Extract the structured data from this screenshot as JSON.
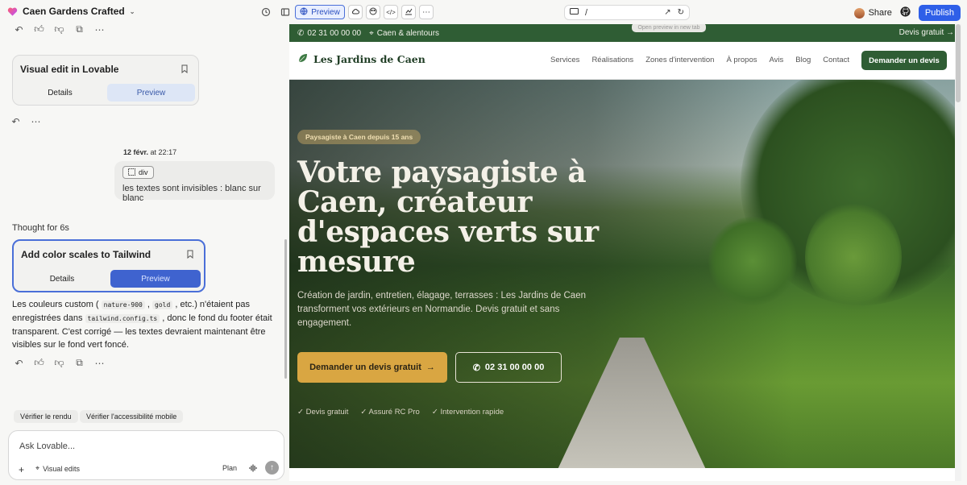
{
  "topbar": {
    "project_name": "Caen Gardens Crafted",
    "preview_label": "Preview",
    "address_path": "/",
    "share_label": "Share",
    "publish_label": "Publish"
  },
  "chat": {
    "card1": {
      "title": "Visual edit in Lovable",
      "details": "Details",
      "preview": "Preview"
    },
    "timestamp_date": "12 févr.",
    "timestamp_time": "at 22:17",
    "user_chip": "div",
    "user_message": "les textes sont invisibles : blanc sur blanc",
    "thought": "Thought for 6s",
    "card2": {
      "title": "Add color scales to Tailwind",
      "details": "Details",
      "preview": "Preview"
    },
    "reply": {
      "p1": "Les couleurs custom (",
      "code1": "nature-900",
      "p2": ",",
      "code2": "gold",
      "p3": ", etc.) n'étaient pas enregistrées dans",
      "code3": "tailwind.config.ts",
      "p4": ", donc le fond du footer était transparent. C'est corrigé — les textes devraient maintenant être visibles sur le fond vert foncé."
    },
    "suggestions": [
      "Vérifier le rendu",
      "Vérifier l'accessibilité mobile"
    ],
    "input_placeholder": "Ask Lovable...",
    "visual_edits": "Visual edits",
    "plan": "Plan"
  },
  "site": {
    "phone": "02 31 00 00 00",
    "area": "Caen & alentours",
    "devis_top": "Devis gratuit →",
    "tooltip": "Open preview in new tab",
    "brand": "Les Jardins de Caen",
    "menu": [
      "Services",
      "Réalisations",
      "Zones d'intervention",
      "À propos",
      "Avis",
      "Blog",
      "Contact"
    ],
    "cta_nav": "Demander un devis",
    "badge": "Paysagiste à Caen depuis 15 ans",
    "headline": "Votre paysagiste à Caen, créateur d'espaces verts sur mesure",
    "lead": "Création de jardin, entretien, élagage, terrasses : Les Jardins de Caen transforment vos extérieurs en Normandie. Devis gratuit et sans engagement.",
    "cta_primary": "Demander un devis gratuit",
    "cta_phone": "02 31 00 00 00",
    "checks": [
      "✓ Devis gratuit",
      "✓ Assuré RC Pro",
      "✓ Intervention rapide"
    ]
  },
  "colors": {
    "accent_blue": "#2e5fe8",
    "forest_green": "#2f5d34",
    "gold": "#d9a642"
  }
}
